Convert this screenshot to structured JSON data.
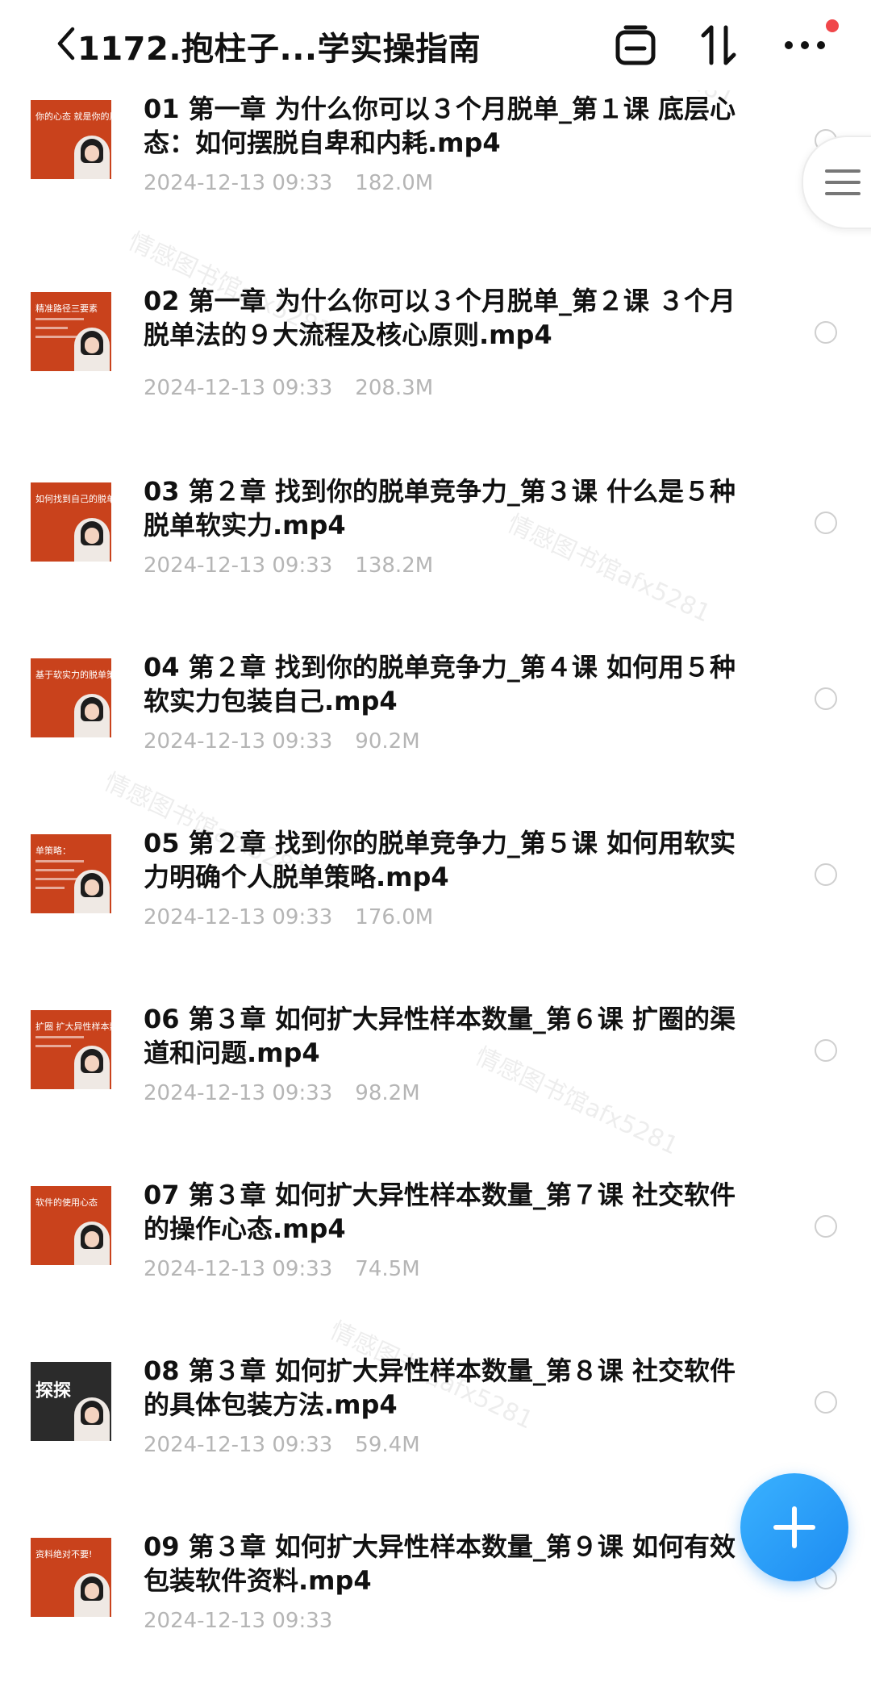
{
  "header": {
    "title": "1172.抱柱子...学实操指南"
  },
  "icons": {
    "back": "chevron-left-icon",
    "clip": "clipboard-icon",
    "sort": "sort-arrows-icon",
    "more": "more-dots-icon",
    "side": "hamburger-menu-icon",
    "fab": "plus-icon"
  },
  "colors": {
    "notification_dot": "#f0464a",
    "fab": "#1d8bf1",
    "thumbnail": "#c9421c",
    "meta_text": "#b5b5b5"
  },
  "files": [
    {
      "name": "01 第一章 为什么你可以３个月脱单_第１课 底层心态：如何摆脱自卑和内耗.mp4",
      "date": "2024-12-13 09:33",
      "size": "182.0M",
      "thumb": "你的心态 就是你的风水"
    },
    {
      "name": "02 第一章 为什么你可以３个月脱单_第２课 ３个月脱单法的９大流程及核心原则.mp4",
      "date": "2024-12-13 09:33",
      "size": "208.3M",
      "thumb": "精准路径三要素"
    },
    {
      "name": "03 第２章 找到你的脱单竞争力_第３课 什么是５种脱单软实力.mp4",
      "date": "2024-12-13 09:33",
      "size": "138.2M",
      "thumb": "如何找到自己的脱单"
    },
    {
      "name": "04 第２章 找到你的脱单竞争力_第４课 如何用５种软实力包装自己.mp4",
      "date": "2024-12-13 09:33",
      "size": "90.2M",
      "thumb": "基于软实力的脱单策略"
    },
    {
      "name": "05 第２章 找到你的脱单竞争力_第５课 如何用软实力明确个人脱单策略.mp4",
      "date": "2024-12-13 09:33",
      "size": "176.0M",
      "thumb": "单策略："
    },
    {
      "name": "06 第３章 如何扩大异性样本数量_第６课 扩圈的渠道和问题.mp4",
      "date": "2024-12-13 09:33",
      "size": "98.2M",
      "thumb": "扩圈 扩大异性样本数量"
    },
    {
      "name": "07 第３章 如何扩大异性样本数量_第７课 社交软件的操作心态.mp4",
      "date": "2024-12-13 09:33",
      "size": "74.5M",
      "thumb": "软件的使用心态"
    },
    {
      "name": "08 第３章 如何扩大异性样本数量_第８课 社交软件的具体包装方法.mp4",
      "date": "2024-12-13 09:33",
      "size": "59.4M",
      "thumb": "探探"
    },
    {
      "name": "09 第３章 如何扩大异性样本数量_第９课 如何有效包装软件资料.mp4",
      "date": "2024-12-13 09:33",
      "size": "",
      "thumb": "资料绝对不要!"
    }
  ],
  "watermark": "情感图书馆afx5281"
}
